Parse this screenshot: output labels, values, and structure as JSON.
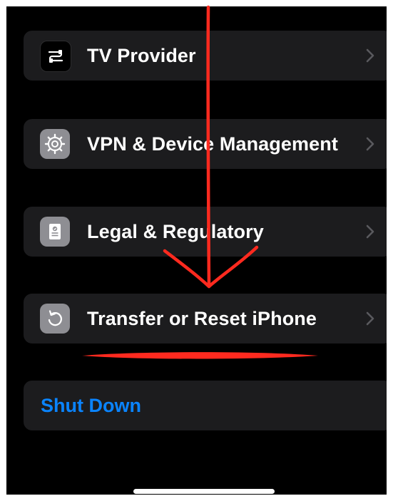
{
  "settings_rows": [
    {
      "label": "TV Provider",
      "icon": "tv-provider-icon",
      "icon_bg": "#000000"
    },
    {
      "label": "VPN & Device Management",
      "icon": "gear-icon",
      "icon_bg": "#8e8e93"
    },
    {
      "label": "Legal & Regulatory",
      "icon": "legal-document-icon",
      "icon_bg": "#8e8e93"
    },
    {
      "label": "Transfer or Reset iPhone",
      "icon": "reset-arrow-icon",
      "icon_bg": "#8e8e93"
    }
  ],
  "shutdown": {
    "label": "Shut Down"
  },
  "colors": {
    "background": "#000000",
    "row_background": "#1c1c1e",
    "text": "#ffffff",
    "link_blue": "#0a84ff",
    "chevron": "#5a5a5e",
    "annotation_red": "#ff2a1f"
  }
}
